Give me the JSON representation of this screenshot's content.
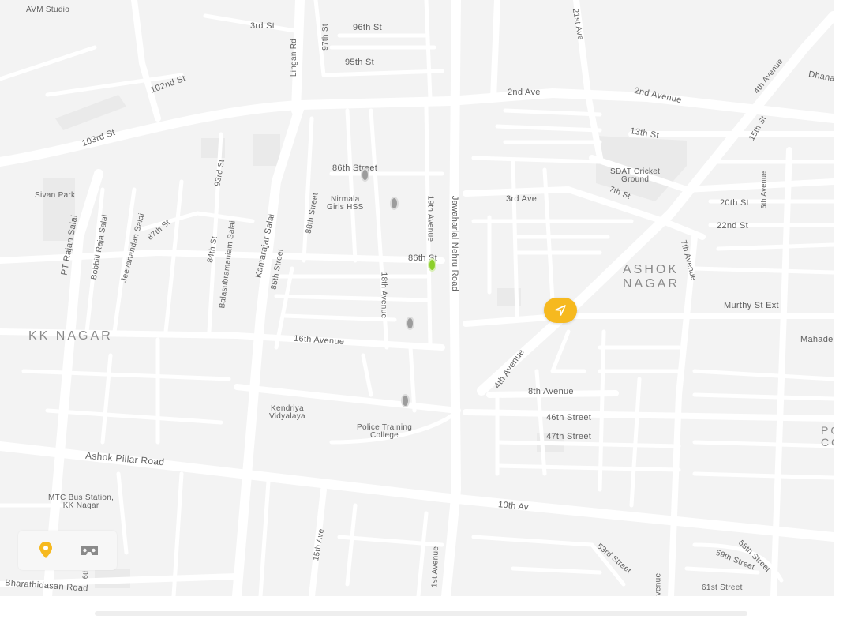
{
  "map": {
    "area_labels": [
      {
        "name": "kk-nagar",
        "text": "KK NAGAR"
      },
      {
        "name": "ashok-nagar",
        "text": "ASHOK\nNAGAR"
      },
      {
        "name": "po-co",
        "text": "PO\nCO"
      }
    ],
    "street_labels": [
      {
        "name": "3rd-st",
        "text": "3rd St"
      },
      {
        "name": "96th-st",
        "text": "96th St"
      },
      {
        "name": "95th-st",
        "text": "95th St"
      },
      {
        "name": "97th-st",
        "text": "97th St"
      },
      {
        "name": "lingan-rd",
        "text": "Lingan Rd"
      },
      {
        "name": "102nd-st",
        "text": "102nd St"
      },
      {
        "name": "103rd-st",
        "text": "103rd St"
      },
      {
        "name": "2nd-ave",
        "text": "2nd Ave"
      },
      {
        "name": "2nd-avenue",
        "text": "2nd Avenue"
      },
      {
        "name": "21st-ave",
        "text": "21st Ave"
      },
      {
        "name": "4th-avenue-ne",
        "text": "4th Avenue"
      },
      {
        "name": "dhana",
        "text": "Dhana"
      },
      {
        "name": "13th-st",
        "text": "13th St"
      },
      {
        "name": "15th-st",
        "text": "15th St"
      },
      {
        "name": "86th-street",
        "text": "86th Street"
      },
      {
        "name": "93rd-st",
        "text": "93rd St"
      },
      {
        "name": "3rd-ave",
        "text": "3rd Ave"
      },
      {
        "name": "7th-st",
        "text": "7th St"
      },
      {
        "name": "20th-st",
        "text": "20th St"
      },
      {
        "name": "5th-avenue",
        "text": "5th Avenue"
      },
      {
        "name": "22nd-st",
        "text": "22nd St"
      },
      {
        "name": "19th-avenue",
        "text": "19th Avenue"
      },
      {
        "name": "jawaharlal-nehru-road",
        "text": "Jawaharlal Nehru Road"
      },
      {
        "name": "86th-st",
        "text": "86th St"
      },
      {
        "name": "88th-street",
        "text": "88th Street"
      },
      {
        "name": "pt-rajan-salai",
        "text": "PT Rajan Salai"
      },
      {
        "name": "bobbili-raja-salai",
        "text": "Bobbili Raja Salai"
      },
      {
        "name": "jeevanandan-salai",
        "text": "Jeevanandan Salai"
      },
      {
        "name": "87th-st",
        "text": "87th St"
      },
      {
        "name": "84th-st",
        "text": "84th St"
      },
      {
        "name": "balasubramaniam-salai",
        "text": "Balasubramaniam Salai"
      },
      {
        "name": "kamarajar-salai",
        "text": "Kamarajar Salai"
      },
      {
        "name": "85th-street",
        "text": "85th Street"
      },
      {
        "name": "18th-avenue",
        "text": "18th Avenue"
      },
      {
        "name": "7th-avenue",
        "text": "7th Avenue"
      },
      {
        "name": "murthy-st-ext",
        "text": "Murthy St Ext"
      },
      {
        "name": "mahade",
        "text": "Mahade"
      },
      {
        "name": "16th-avenue",
        "text": "16th Avenue"
      },
      {
        "name": "4th-avenue-sw",
        "text": "4th Avenue"
      },
      {
        "name": "8th-avenue",
        "text": "8th Avenue"
      },
      {
        "name": "46th-street",
        "text": "46th Street"
      },
      {
        "name": "47th-street",
        "text": "47th Street"
      },
      {
        "name": "ashok-pillar-road",
        "text": "Ashok Pillar Road"
      },
      {
        "name": "10th-av",
        "text": "10th Av"
      },
      {
        "name": "15th-ave",
        "text": "15th Ave"
      },
      {
        "name": "1st-avenue",
        "text": "1st Avenue"
      },
      {
        "name": "53rd-street",
        "text": "53rd Street"
      },
      {
        "name": "58th-street",
        "text": "58th Street"
      },
      {
        "name": "59th-street",
        "text": "59th Street"
      },
      {
        "name": "61st-street",
        "text": "61st Street"
      },
      {
        "name": "avenue-bottom",
        "text": "venue"
      },
      {
        "name": "bharathidasan-road",
        "text": "Bharathidasan Road"
      },
      {
        "name": "6th",
        "text": "6th"
      }
    ],
    "poi_labels": [
      {
        "name": "avm-studio",
        "text": "AVM Studio"
      },
      {
        "name": "sivan-park",
        "text": "Sivan Park"
      },
      {
        "name": "nirmala-girls-hss",
        "text": "Nirmala\nGirls HSS"
      },
      {
        "name": "sdat-cricket-ground",
        "text": "SDAT Cricket\nGround"
      },
      {
        "name": "kendriya-vidyalaya",
        "text": "Kendriya\nVidyalaya"
      },
      {
        "name": "police-training-college",
        "text": "Police Training\nCollege"
      },
      {
        "name": "mtc-bus-station",
        "text": "MTC Bus Station,\nKK Nagar"
      }
    ]
  },
  "markers": {
    "current_location": {
      "icon": "navigation-arrow-icon",
      "color": "#f6b91f"
    },
    "pins": [
      {
        "name": "pin-1",
        "state": "default"
      },
      {
        "name": "pin-2",
        "state": "default"
      },
      {
        "name": "pin-3",
        "state": "active"
      },
      {
        "name": "pin-4",
        "state": "default"
      },
      {
        "name": "pin-5",
        "state": "default"
      }
    ]
  },
  "controls": {
    "location_icon": "map-pin-icon",
    "vr_icon": "vr-headset-icon",
    "accent": "#f6b91f"
  }
}
